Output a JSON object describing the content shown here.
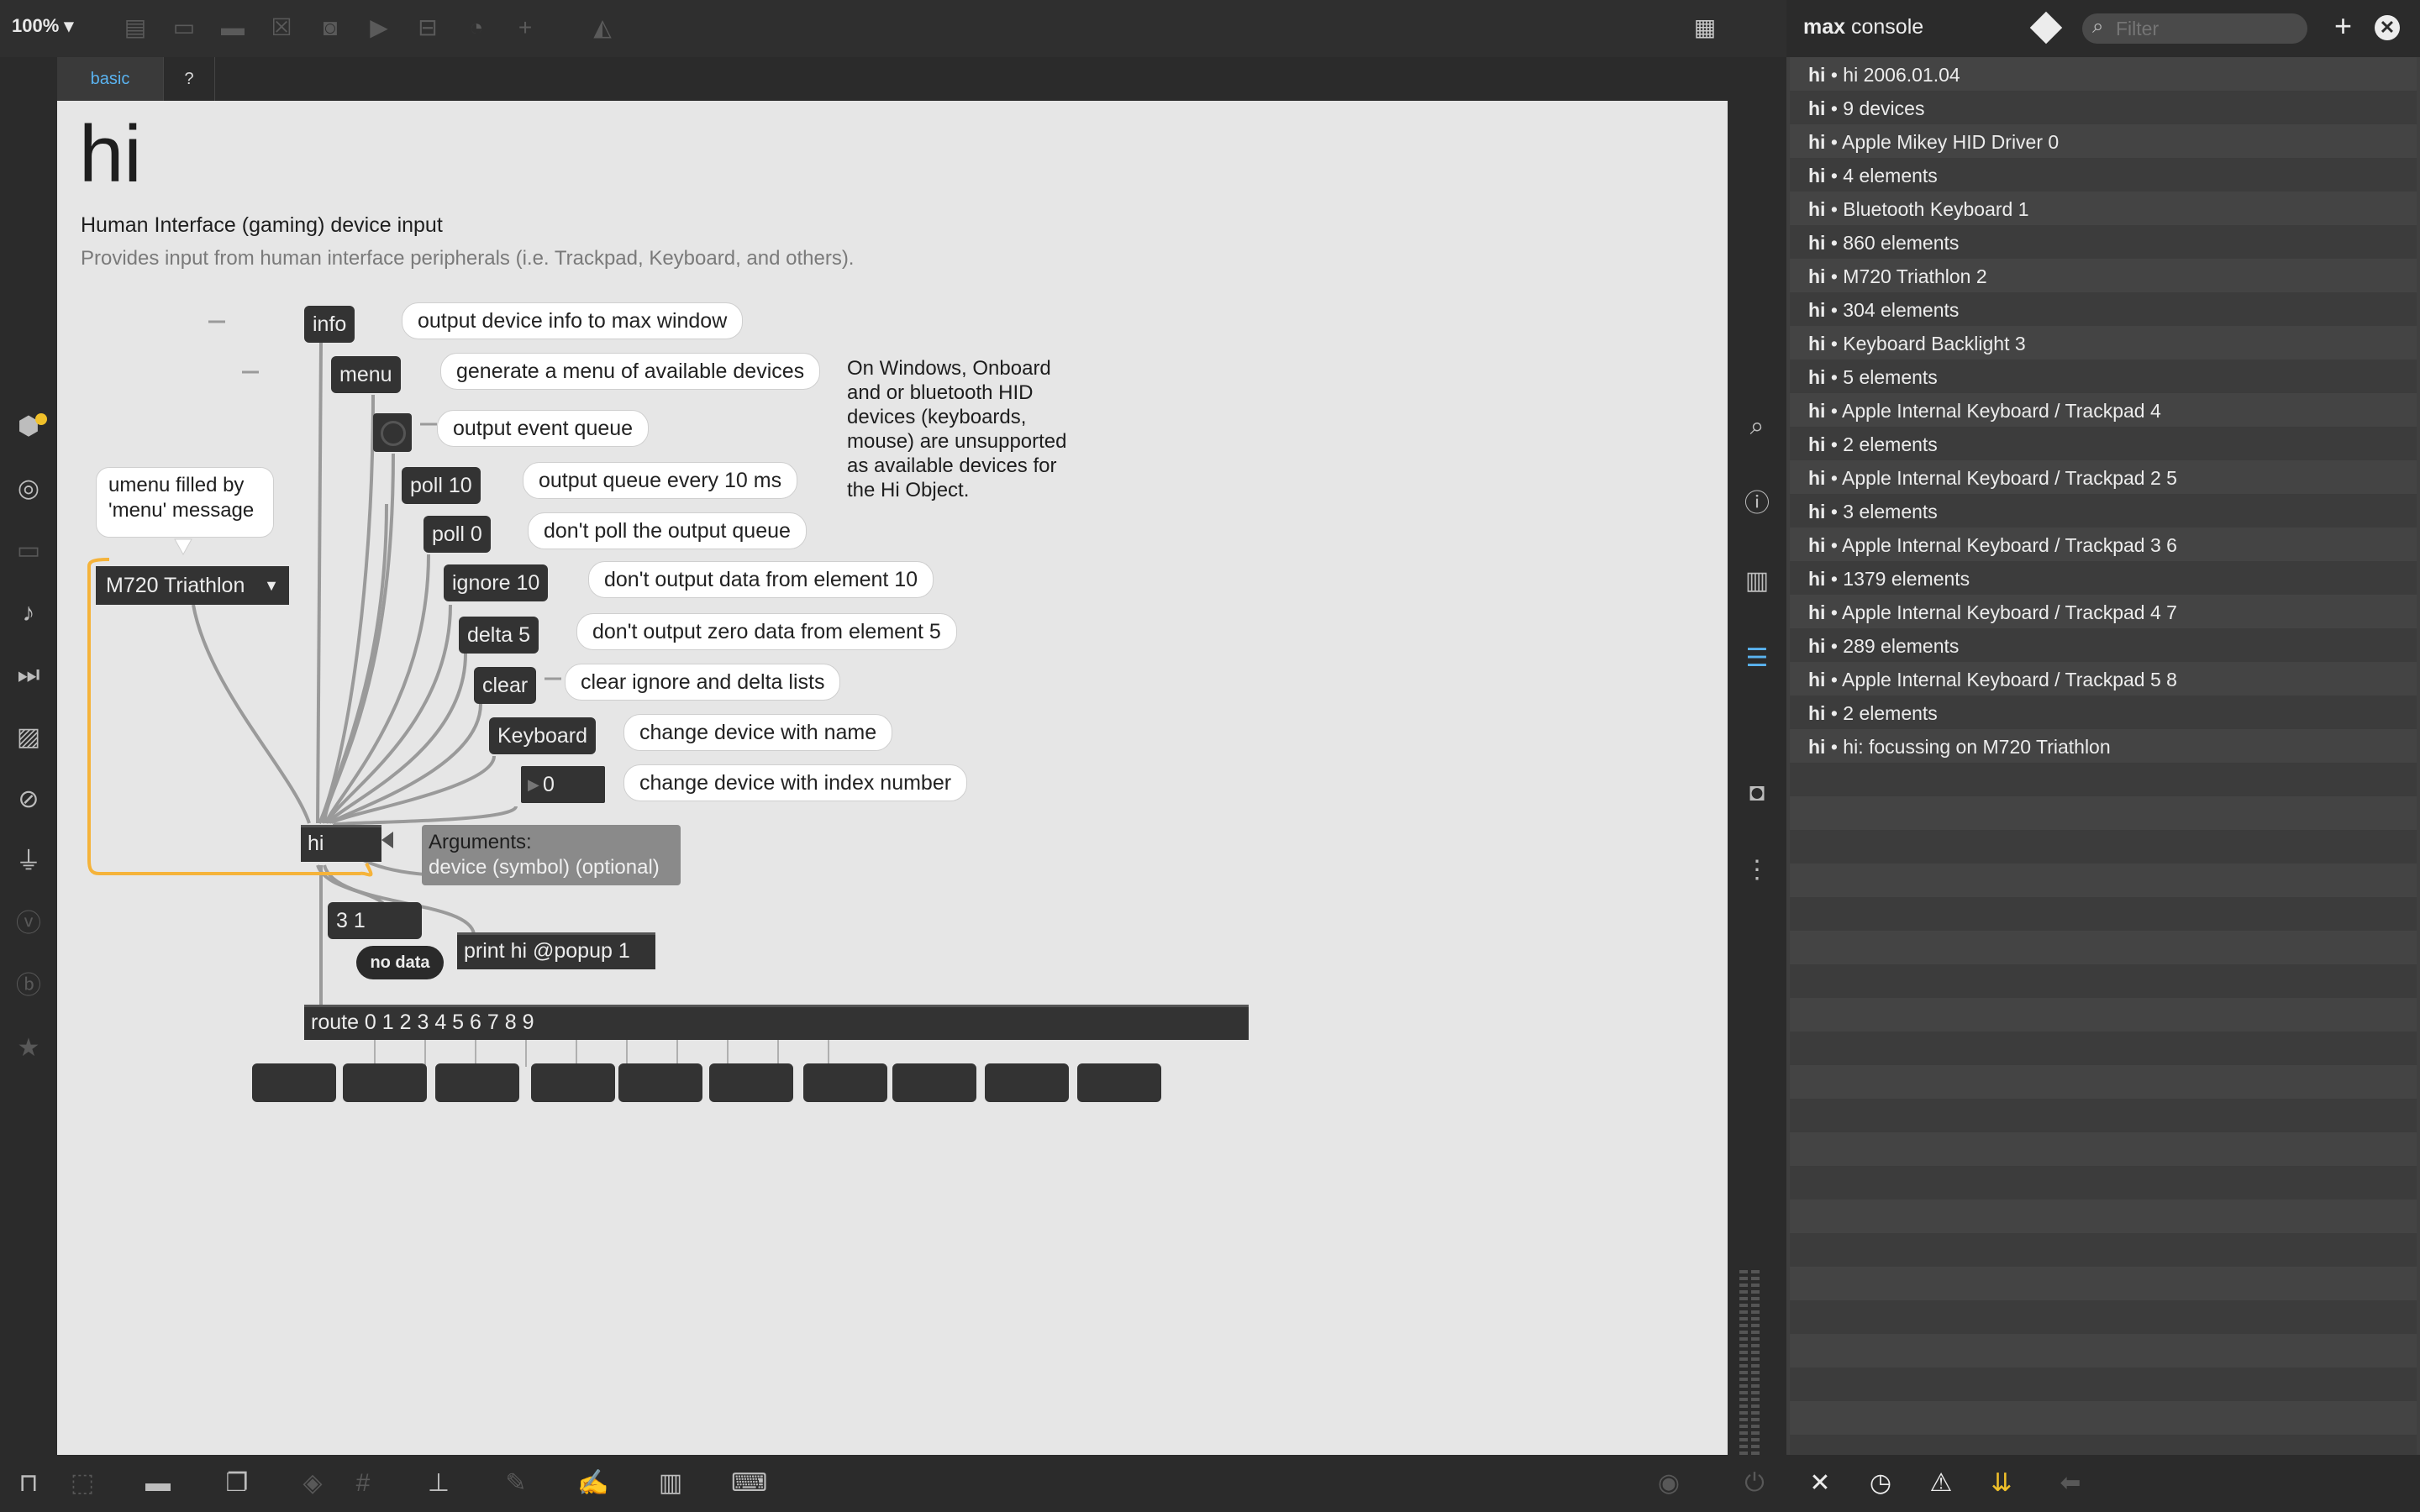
{
  "toolbar": {
    "zoom": "100%",
    "icons": [
      "presentation-mode-icon",
      "text-object-icon",
      "comment-icon",
      "close-box-icon",
      "toggle-icon",
      "play-icon",
      "slider-icon",
      "dial-icon",
      "add-icon",
      "paint-bucket-icon",
      "grid-icon"
    ]
  },
  "tabs": [
    {
      "label": "basic",
      "active": true
    },
    {
      "label": "?",
      "active": false
    }
  ],
  "patch": {
    "title": "hi",
    "subtitle": "Human Interface (gaming) device input",
    "description": "Provides input from human interface peripherals (i.e. Trackpad, Keyboard, and others).",
    "messages": {
      "info": "info",
      "menu": "menu",
      "poll10": "poll 10",
      "poll0": "poll 0",
      "ignore": "ignore 10",
      "delta": "delta 5",
      "clear": "clear",
      "keyboard": "Keyboard",
      "number": "0",
      "out": "3 1"
    },
    "comments": {
      "info": "output device info to max window",
      "menu": "generate a menu of available devices",
      "toggle": "output event queue",
      "poll10": "output queue every 10 ms",
      "poll0": "don't poll the output queue",
      "ignore": "don't output data from element 10",
      "delta": "don't output zero data from element 5",
      "clear": "clear ignore and delta lists",
      "keyboard": "change device with name",
      "number": "change device with index number"
    },
    "windows_note": [
      "On Windows, Onboard",
      "and or bluetooth HID",
      "devices (keyboards,",
      "mouse) are unsupported",
      "as available devices for",
      "the Hi Object."
    ],
    "umenu_note": [
      "umenu filled by",
      "'menu' message"
    ],
    "umenu_value": "M720 Triathlon",
    "hi_object": "hi",
    "arguments_title": "Arguments:",
    "arguments_value": "device (symbol) (optional)",
    "no_data": "no data",
    "print": "print hi @popup 1",
    "route": "route 0 1 2 3 4 5 6 7 8 9"
  },
  "console": {
    "title_bold": "max",
    "title_rest": "console",
    "filter_placeholder": "Filter",
    "lines": [
      {
        "src": "hi",
        "msg": "• hi 2006.01.04"
      },
      {
        "src": "hi",
        "msg": "• 9 devices"
      },
      {
        "src": "hi",
        "msg": "• Apple Mikey HID Driver 0"
      },
      {
        "src": "hi",
        "msg": "• 4 elements"
      },
      {
        "src": "hi",
        "msg": "• Bluetooth Keyboard 1"
      },
      {
        "src": "hi",
        "msg": "• 860 elements"
      },
      {
        "src": "hi",
        "msg": "• M720 Triathlon 2"
      },
      {
        "src": "hi",
        "msg": "• 304 elements"
      },
      {
        "src": "hi",
        "msg": "• Keyboard Backlight 3"
      },
      {
        "src": "hi",
        "msg": "• 5 elements"
      },
      {
        "src": "hi",
        "msg": "• Apple Internal Keyboard / Trackpad 4"
      },
      {
        "src": "hi",
        "msg": "• 2 elements"
      },
      {
        "src": "hi",
        "msg": "• Apple Internal Keyboard / Trackpad 2 5"
      },
      {
        "src": "hi",
        "msg": "• 3 elements"
      },
      {
        "src": "hi",
        "msg": "• Apple Internal Keyboard / Trackpad 3 6"
      },
      {
        "src": "hi",
        "msg": "• 1379 elements"
      },
      {
        "src": "hi",
        "msg": "• Apple Internal Keyboard / Trackpad 4 7"
      },
      {
        "src": "hi",
        "msg": "• 289 elements"
      },
      {
        "src": "hi",
        "msg": "• Apple Internal Keyboard / Trackpad 5 8"
      },
      {
        "src": "hi",
        "msg": "• 2 elements"
      },
      {
        "src": "hi",
        "msg": "• hi: focussing on M720 Triathlon"
      }
    ]
  },
  "colors": {
    "accent_yellow": "#f0c02a",
    "tab_active": "#5ab3f0",
    "canvas": "#e6e6e6",
    "object": "#333333",
    "patchcord_orange": "#f5b33a"
  }
}
